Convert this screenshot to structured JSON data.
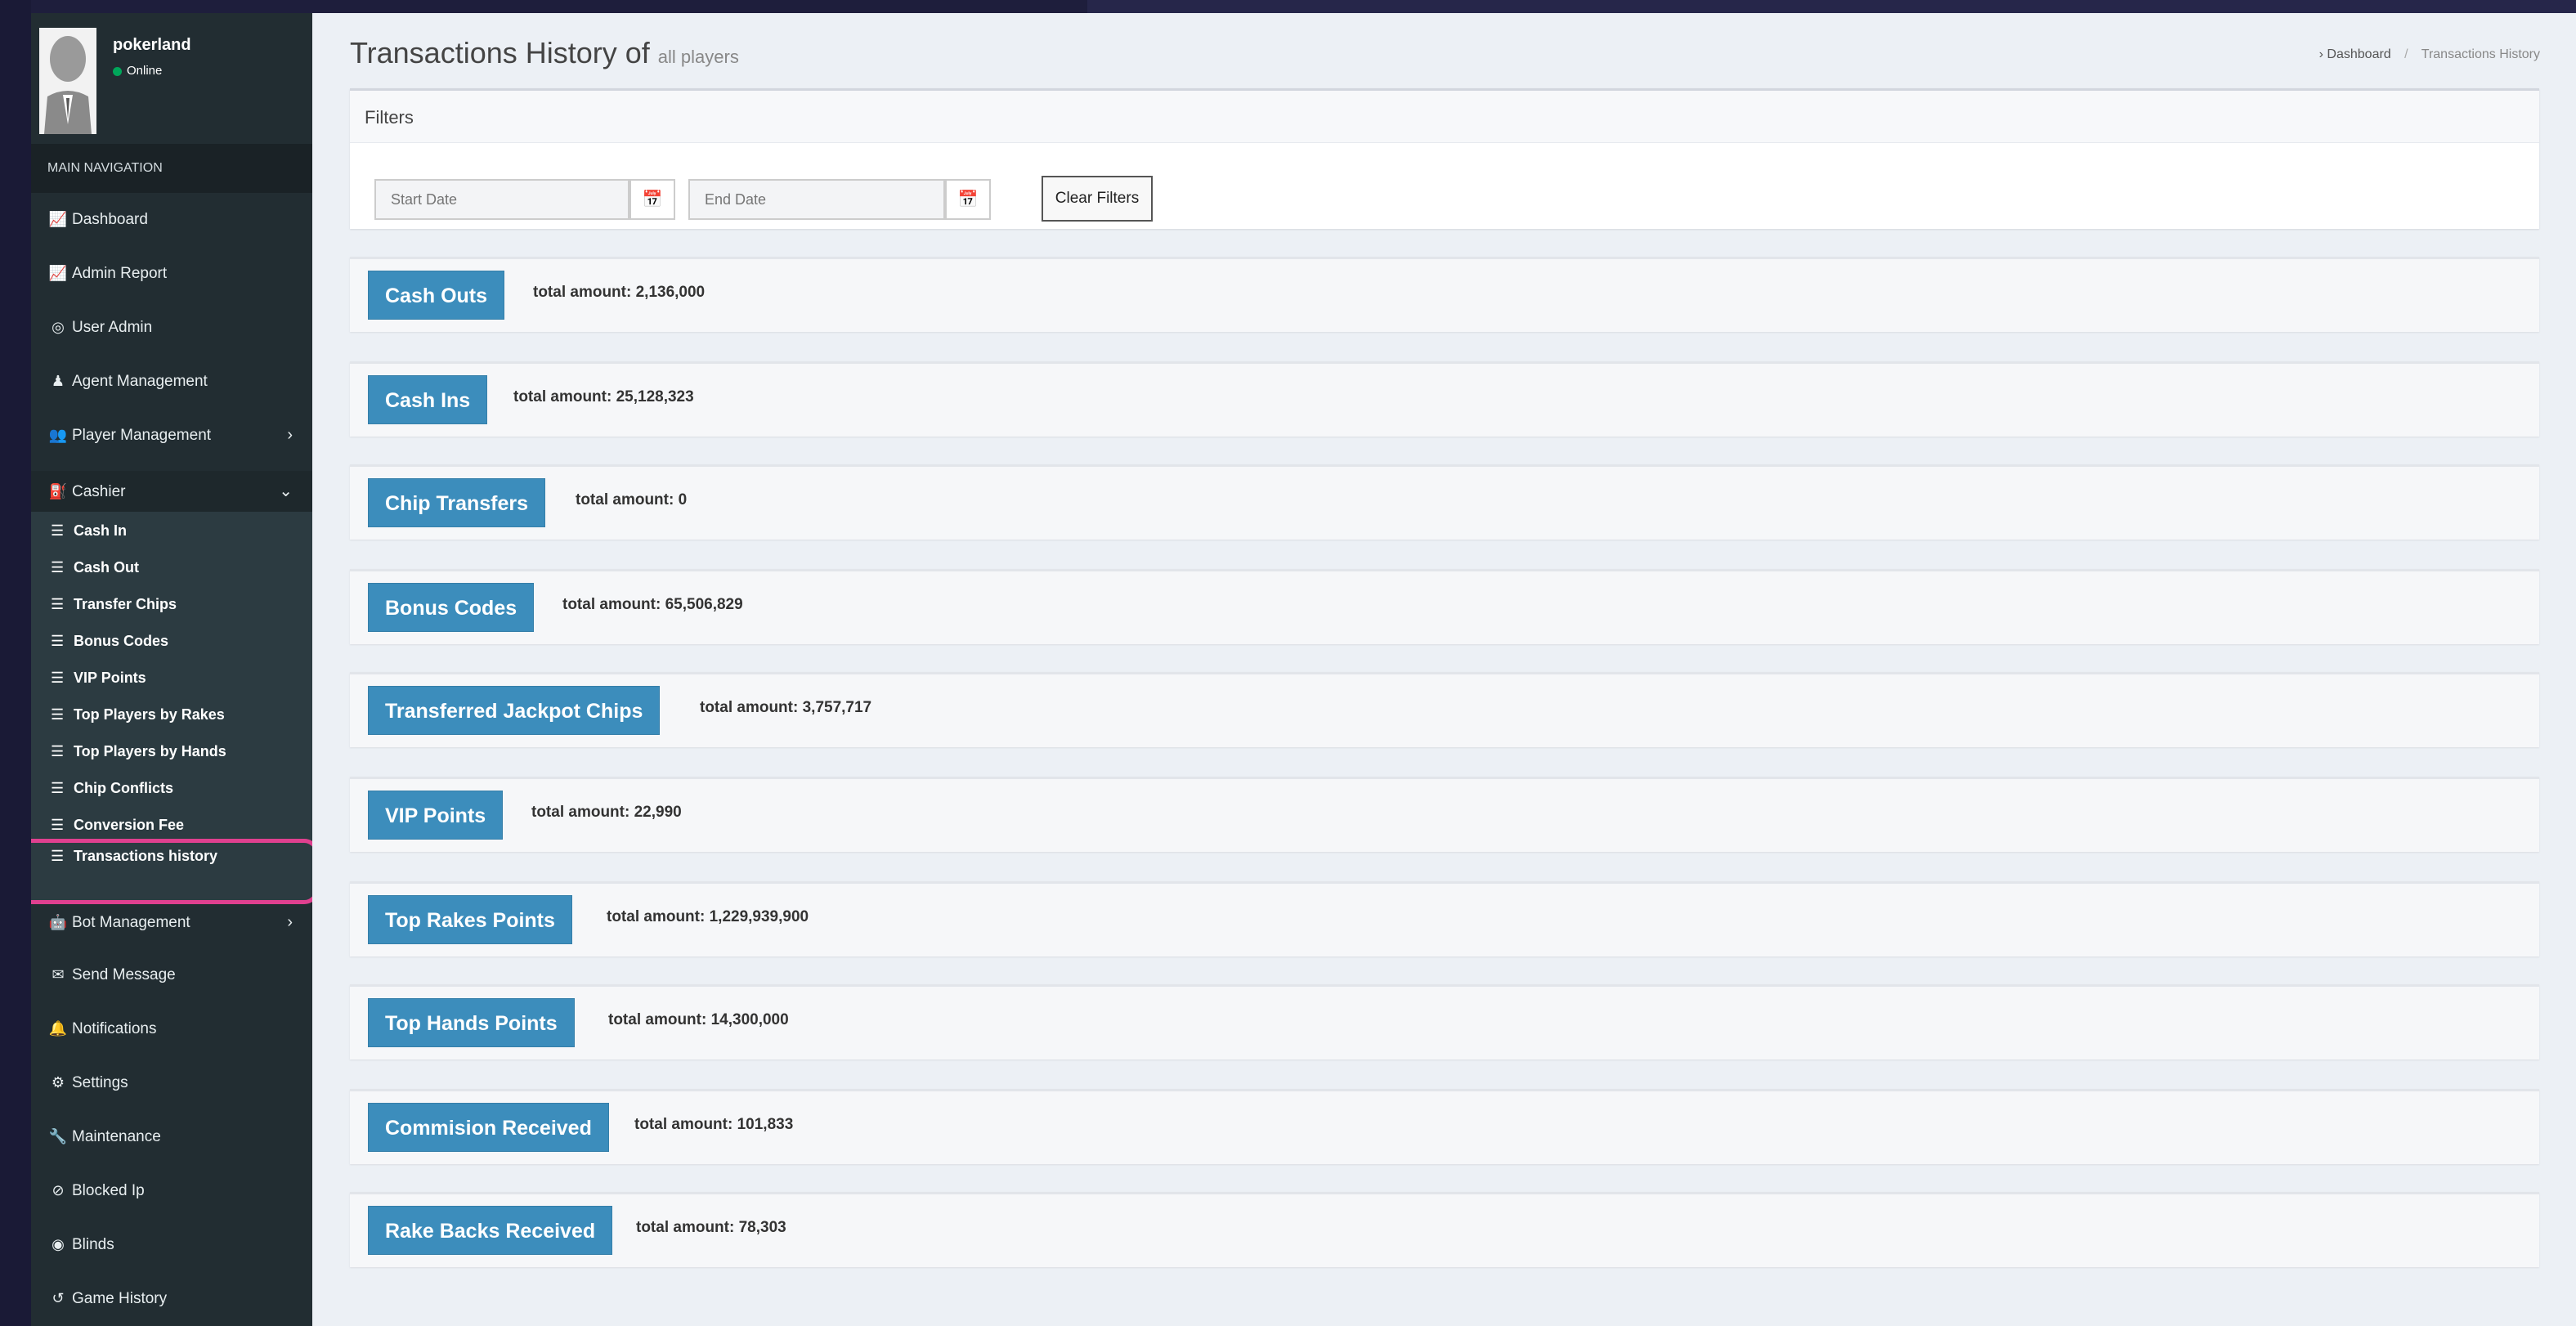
{
  "sidebar": {
    "user": {
      "name": "pokerland",
      "status": "Online"
    },
    "nav_header": "MAIN NAVIGATION",
    "items": [
      {
        "label": "Dashboard",
        "icon": "line-chart-icon"
      },
      {
        "label": "Admin Report",
        "icon": "line-chart-icon"
      },
      {
        "label": "User Admin",
        "icon": "user-circle-icon"
      },
      {
        "label": "Agent Management",
        "icon": "agent-icon"
      },
      {
        "label": "Player Management",
        "icon": "users-icon"
      },
      {
        "label": "Cashier",
        "icon": "cashier-icon"
      },
      {
        "label": "Bot Management",
        "icon": "bot-icon"
      },
      {
        "label": "Send Message",
        "icon": "envelope-icon"
      },
      {
        "label": "Notifications",
        "icon": "bell-icon"
      },
      {
        "label": "Settings",
        "icon": "gear-icon"
      },
      {
        "label": "Maintenance",
        "icon": "wrench-icon"
      },
      {
        "label": "Blocked Ip",
        "icon": "blocked-icon"
      },
      {
        "label": "Blinds",
        "icon": "blinds-icon"
      },
      {
        "label": "Game History",
        "icon": "history-icon"
      }
    ],
    "cashier_sub": [
      {
        "label": "Cash In"
      },
      {
        "label": "Cash Out"
      },
      {
        "label": "Transfer Chips"
      },
      {
        "label": "Bonus Codes"
      },
      {
        "label": "VIP Points"
      },
      {
        "label": "Top Players by Rakes"
      },
      {
        "label": "Top Players by Hands"
      },
      {
        "label": "Chip Conflicts"
      },
      {
        "label": "Conversion Fee"
      },
      {
        "label": "Transactions history"
      }
    ]
  },
  "header": {
    "title": "Transactions History of",
    "subtitle": "all players",
    "breadcrumb": [
      "Dashboard",
      "Transactions History"
    ]
  },
  "filters": {
    "title": "Filters",
    "start_placeholder": "Start Date",
    "end_placeholder": "End Date",
    "clear_label": "Clear Filters"
  },
  "totals": [
    {
      "label": "Cash Outs",
      "total": "total amount: 2,136,000"
    },
    {
      "label": "Cash Ins",
      "total": "total amount: 25,128,323"
    },
    {
      "label": "Chip Transfers",
      "total": "total amount: 0"
    },
    {
      "label": "Bonus Codes",
      "total": "total amount: 65,506,829"
    },
    {
      "label": "Transferred Jackpot Chips",
      "total": "total amount: 3,757,717"
    },
    {
      "label": "VIP Points",
      "total": "total amount: 22,990"
    },
    {
      "label": "Top Rakes Points",
      "total": "total amount: 1,229,939,900"
    },
    {
      "label": "Top Hands Points",
      "total": "total amount: 14,300,000"
    },
    {
      "label": "Commision Received",
      "total": "total amount: 101,833"
    },
    {
      "label": "Rake Backs Received",
      "total": "total amount: 78,303"
    }
  ],
  "colors": {
    "accent": "#3c8dbc",
    "sidebar": "#222d32",
    "highlight": "#e0408f",
    "online": "#00a65a"
  }
}
